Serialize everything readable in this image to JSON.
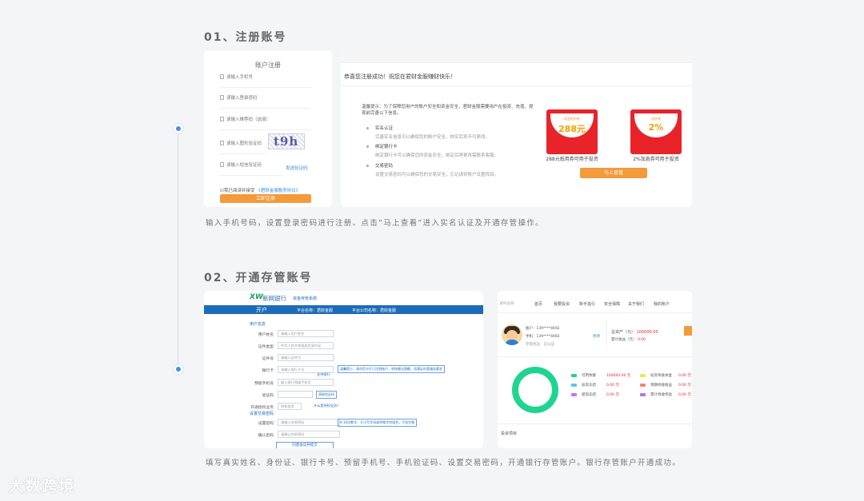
{
  "step1": {
    "title": "01、注册账号",
    "desc": "输入手机号码，设置登录密码进行注册、点击”马上查看”进入实名认证及开通存管操作。",
    "register_card": {
      "title": "账户注册",
      "fields": [
        {
          "placeholder": "请输入手机号"
        },
        {
          "placeholder": "请输入登录密码"
        },
        {
          "placeholder": "请输入推荐码（选填）"
        },
        {
          "placeholder": "请输入图形验证码"
        },
        {
          "placeholder": "请输入短信验证码"
        }
      ],
      "captcha_text": "t9h",
      "send_code": "发送验证码",
      "agree_text": "我已阅读并接受",
      "agreement_link": "《君财金服服务协议》",
      "submit": "立即注册"
    },
    "success_card": {
      "heading": "恭喜您注册成功！祝您在君财金服赚财快乐！",
      "tip": "温馨提示：为了保障您用户的账户安全和资金安全，君财金服需要用户在投资、充值、提现前完善以下信息。",
      "items": [
        {
          "title": "实名认证",
          "desc": "完善实名信息可以确保您的账户安全，核实后将不可更改。"
        },
        {
          "title": "绑定银行卡",
          "desc": "绑定银行卡可以确保您的资金安全，绑定后再更改需联系客服。"
        },
        {
          "title": "交易密码",
          "desc": "设置交易密码可以确保您的交易安全，忘记请到账户设置找回。"
        }
      ],
      "packets": [
        {
          "small": "现金抵扣券",
          "big": "288元",
          "caption": "288元抵用券可用于投资"
        },
        {
          "small": "加息券",
          "big": "2%",
          "caption": "2%加息券可用于投资"
        }
      ],
      "view_button": "马上查看"
    }
  },
  "step2": {
    "title": "02、开通存管账号",
    "desc": "填写真实姓名、身份证、银行卡号、预留手机号、手机验证码、设置交易密码，开通银行存管账户。银行存管账户开通成功。",
    "bank_card": {
      "logo": "XW",
      "bank_name": "新网银行",
      "system": "资金存管系统",
      "tab": "开户",
      "platform_name": "平台名称：君财金服",
      "company_name": "平台公司名称：君财金服",
      "section_user": "用户信息",
      "fields": [
        {
          "label": "用户姓名",
          "placeholder": "请输入用户姓名"
        },
        {
          "label": "证件类型",
          "placeholder": "中华人民共和国居民身份证"
        },
        {
          "label": "证件号",
          "placeholder": "请输入证件号"
        },
        {
          "label": "银行卡",
          "placeholder": "请输入银行卡号"
        },
        {
          "label": "预留手机号",
          "placeholder": "输入银行预留手机号"
        },
        {
          "label": "验证码",
          "placeholder": ""
        },
        {
          "label": "开通授权业务",
          "placeholder": "授权投资"
        }
      ],
      "bank_note": "温馨提示：请勿用卡片已注销账户，转快捷无限额，须满足存管服务要求",
      "support_link": "支持银行",
      "fetch_code": "获取验证码",
      "auth_link": "什么是授权业务？",
      "section_pwd": "设置交易密码",
      "pwd_fields": [
        {
          "label": "设置密码",
          "placeholder": "请输入交易密码"
        },
        {
          "label": "确认密码",
          "placeholder": "请确认交易密码"
        }
      ],
      "pwd_note": "6-16位数字、大小写字母或特殊字符组合，不含空格",
      "submit": "同意协议并提交"
    },
    "dashboard_card": {
      "brand": "君财金服",
      "nav": [
        "首页",
        "我要投资",
        "新手指引",
        "安全保障",
        "关于我们",
        "我的账户"
      ],
      "account": "账户：139****4692",
      "phone": "手机：139****4692",
      "deposit": "存管状态：已认证",
      "link": "修改",
      "total_label": "总资产（元）",
      "total_value": "100000.00",
      "month_label": "累计收益（元）",
      "month_value": "0.00",
      "legend_left": [
        {
          "label": "可用余额",
          "value": "100000.00 元",
          "color": "#1fd491"
        },
        {
          "label": "投资冻结",
          "value": "0.00 元",
          "color": "#55c8f0"
        },
        {
          "label": "提现冻结",
          "value": "0.00 元",
          "color": "#c874e8"
        }
      ],
      "legend_right": [
        {
          "label": "投资待收本金",
          "value": "0.00 元",
          "color": "#f5e342"
        },
        {
          "label": "预期待收收益",
          "value": "0.00 元",
          "color": "#f7846a"
        },
        {
          "label": "累计待收奖励",
          "value": "0.00 元",
          "color": "#a87de8"
        }
      ],
      "bottom_label": "投资项目"
    }
  },
  "watermark": "大数跨境"
}
